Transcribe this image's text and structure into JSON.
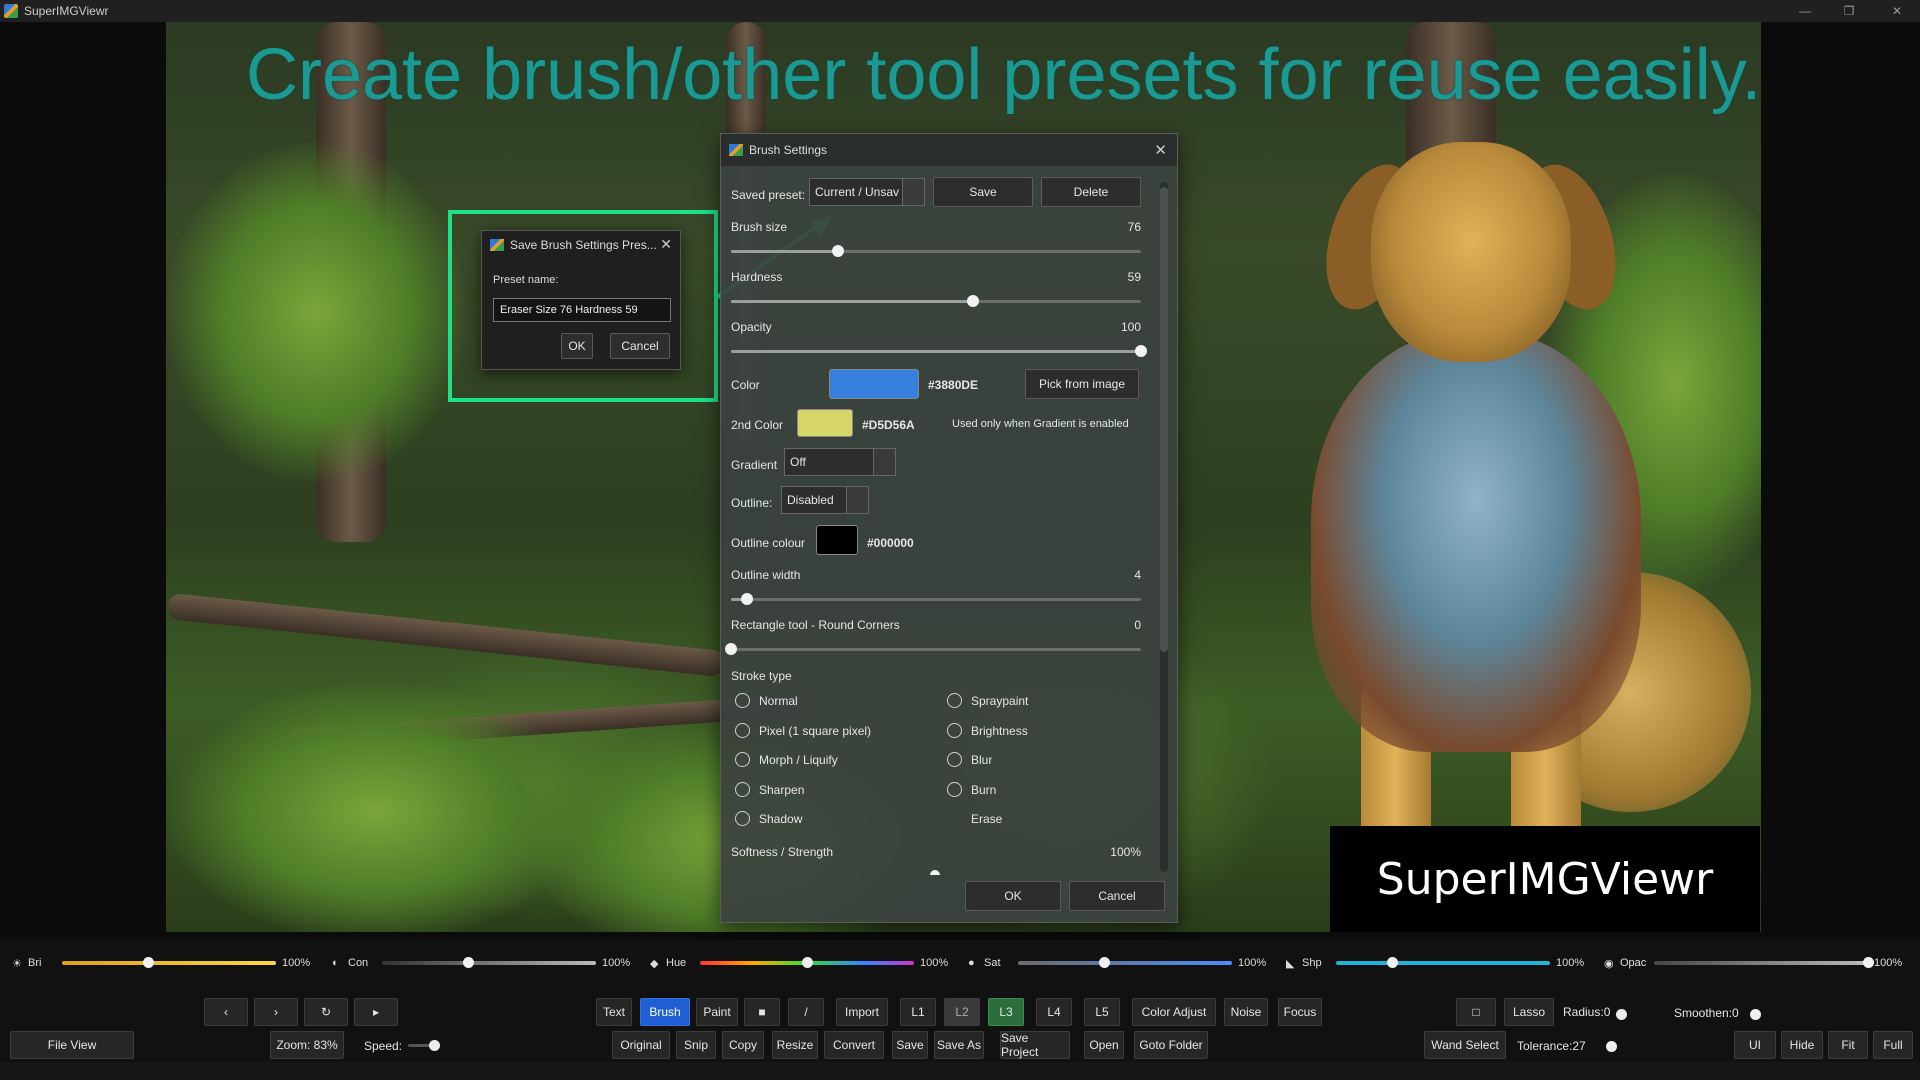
{
  "app": {
    "title": "SuperIMGViewr"
  },
  "canvas": {
    "headline": "Create brush/other tool presets for reuse easily.",
    "brand": "SuperIMGViewr"
  },
  "preset_dialog": {
    "title": "Save Brush Settings Pres...",
    "label": "Preset name:",
    "value": "Eraser Size 76 Hardness 59",
    "ok": "OK",
    "cancel": "Cancel"
  },
  "brush": {
    "title": "Brush Settings",
    "saved_preset_label": "Saved preset:",
    "saved_preset_value": "Current / Unsav",
    "save": "Save",
    "delete": "Delete",
    "brush_size": {
      "label": "Brush size",
      "value": "76",
      "fraction": 0.26
    },
    "hardness": {
      "label": "Hardness",
      "value": "59",
      "fraction": 0.59
    },
    "opacity": {
      "label": "Opacity",
      "value": "100",
      "fraction": 1.0
    },
    "color": {
      "label": "Color",
      "hex": "#3880DE",
      "swatch": "#3880DE",
      "pick": "Pick from image"
    },
    "color2": {
      "label": "2nd Color",
      "hex": "#D5D56A",
      "swatch": "#D5D56A",
      "note": "Used only when Gradient is enabled"
    },
    "gradient": {
      "label": "Gradient",
      "value": "Off"
    },
    "outline": {
      "label": "Outline:",
      "value": "Disabled"
    },
    "outline_colour": {
      "label": "Outline colour",
      "hex": "#000000",
      "swatch": "#000000"
    },
    "outline_width": {
      "label": "Outline width",
      "value": "4",
      "fraction": 0.04
    },
    "round_corners": {
      "label": "Rectangle tool - Round Corners",
      "value": "0",
      "fraction": 0.0
    },
    "stroke_type_label": "Stroke type",
    "stroke_left": [
      "Normal",
      "Pixel (1 square pixel)",
      "Morph / Liquify",
      "Sharpen",
      "Shadow"
    ],
    "stroke_right": [
      "Spraypaint",
      "Brightness",
      "Blur",
      "Burn",
      "Erase"
    ],
    "softness": {
      "label": "Softness / Strength",
      "value": "100%"
    },
    "ok": "OK",
    "cancel": "Cancel"
  },
  "adjust": [
    {
      "icon": "☀",
      "name": "Bri",
      "pct": "100%",
      "fraction": 0.4
    },
    {
      "icon": "◐",
      "name": "Con",
      "pct": "100%",
      "fraction": 0.4
    },
    {
      "icon": "◆",
      "name": "Hue",
      "pct": "100%",
      "fraction": 0.5
    },
    {
      "icon": "●",
      "name": "Sat",
      "pct": "100%",
      "fraction": 0.4
    },
    {
      "icon": "◣",
      "name": "Shp",
      "pct": "100%",
      "fraction": 0.26
    },
    {
      "icon": "◉",
      "name": "Opac",
      "pct": "100%",
      "fraction": 1.0
    }
  ],
  "nav": {
    "prev": "‹",
    "next": "›",
    "rotate": "↻",
    "play": "▸"
  },
  "tools_row1": [
    "Text",
    "Brush",
    "Paint",
    "■",
    "/",
    "Import",
    "L1",
    "L2",
    "L3",
    "L4",
    "L5",
    "Color Adjust",
    "Noise",
    "Focus"
  ],
  "tools_row2": [
    "Original",
    "Snip",
    "Copy",
    "Resize",
    "Convert",
    "Save",
    "Save As",
    "Save Project",
    "Open",
    "Goto Folder"
  ],
  "select": {
    "rect": "□",
    "lasso": "Lasso",
    "radius": "Radius:0",
    "smoothen": "Smoothen:0",
    "wand": "Wand Select",
    "tolerance": "Tolerance:27"
  },
  "view": {
    "file_view": "File View",
    "zoom": "Zoom: 83%",
    "speed": "Speed:",
    "ui": "UI",
    "hide": "Hide",
    "fit": "Fit",
    "full": "Full"
  }
}
